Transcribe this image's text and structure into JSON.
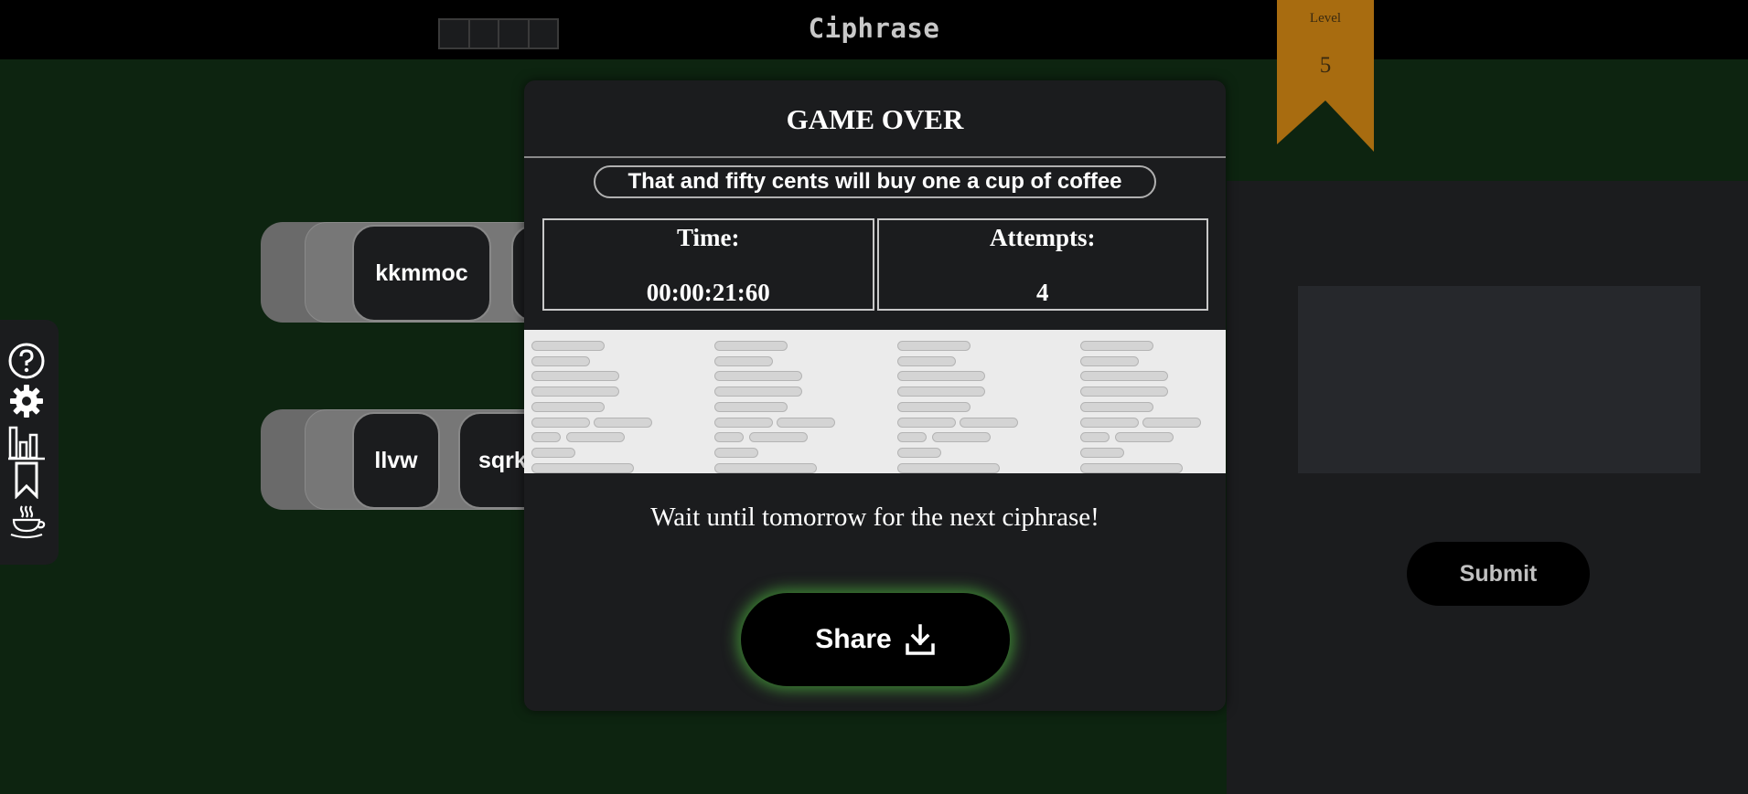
{
  "header": {
    "app_title": "Ciphrase",
    "progress_box_count": 4
  },
  "level": {
    "label": "Level",
    "value": "5",
    "color": "#a86c10"
  },
  "sidebar": {
    "icons": [
      "help-icon",
      "gear-icon",
      "stats-icon",
      "bookmark-icon",
      "coffee-icon"
    ]
  },
  "board": {
    "rows": [
      {
        "words": [
          "kkmmoc",
          ""
        ]
      },
      {
        "words": [
          "llvw",
          "sqrk"
        ]
      }
    ]
  },
  "modal": {
    "title": "GAME OVER",
    "phrase": "That and fifty cents will buy one a cup of coffee",
    "stats": {
      "time_label": "Time:",
      "time_value": "00:00:21:60",
      "attempts_label": "Attempts:",
      "attempts_value": "4"
    },
    "wait_message": "Wait until tomorrow for the next ciphrase!",
    "share_label": "Share"
  },
  "right_panel": {
    "submit_label": "Submit"
  },
  "colors": {
    "background": "#0d2410",
    "panel": "#1b1c1e",
    "share_glow": "#4aaa3c",
    "ribbon": "#a86c10"
  }
}
